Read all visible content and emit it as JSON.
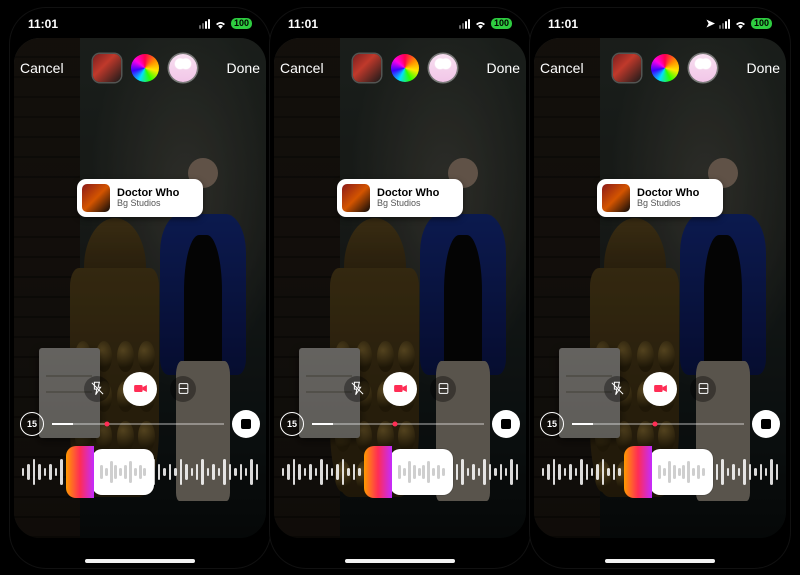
{
  "status": {
    "time": "11:01",
    "battery": "100"
  },
  "header": {
    "cancel": "Cancel",
    "done": "Done"
  },
  "music": {
    "title": "Doctor Who",
    "artist": "Bg Studios"
  },
  "duration_label": "15",
  "screens": [
    {
      "show_location_icon": false,
      "progress_pct": 12,
      "marker_pct": 32,
      "sel_left_pct": 30,
      "sel_width_pct": 26
    },
    {
      "show_location_icon": false,
      "progress_pct": 12,
      "marker_pct": 48,
      "sel_left_pct": 46,
      "sel_width_pct": 26
    },
    {
      "show_location_icon": true,
      "progress_pct": 12,
      "marker_pct": 48,
      "sel_left_pct": 46,
      "sel_width_pct": 26
    }
  ]
}
